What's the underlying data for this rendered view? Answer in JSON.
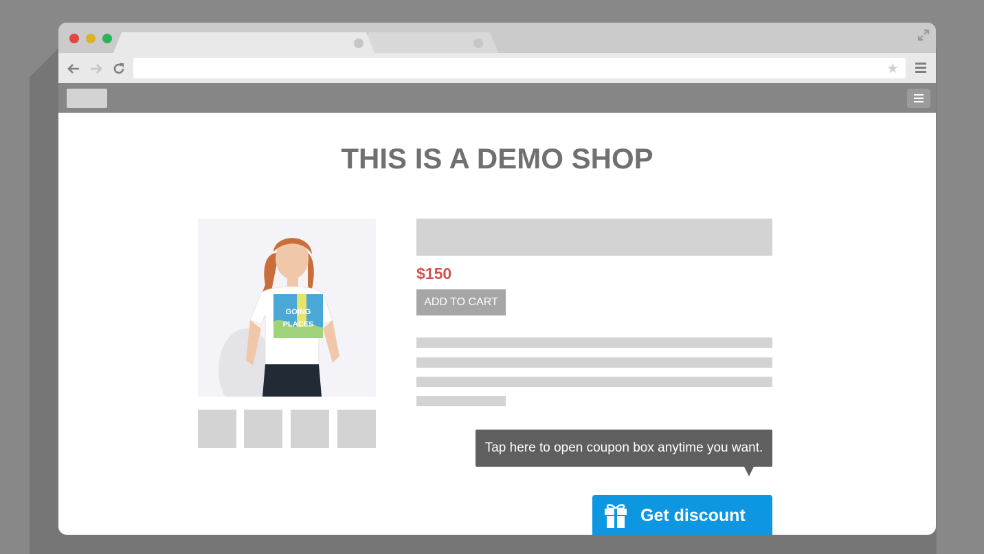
{
  "shop": {
    "title": "THIS IS A DEMO SHOP",
    "price": "$150",
    "add_to_cart_label": "ADD TO CART",
    "tooltip_text": "Tap here to open coupon box anytime you want.",
    "discount_button_label": "Get discount"
  },
  "browser": {
    "icons": [
      "back-icon",
      "forward-icon",
      "reload-icon",
      "star-icon",
      "menu-icon",
      "expand-icon"
    ],
    "window_controls": [
      "close",
      "minimize",
      "maximize"
    ]
  },
  "product_image": {
    "shirt_text_line1": "GOING",
    "shirt_text_line2": "PLACES"
  },
  "colors": {
    "accent": "#0c97e0",
    "price": "#d25252",
    "title": "#707070",
    "placeholder": "#d3d3d3",
    "tooltip": "#5f5f5f"
  }
}
